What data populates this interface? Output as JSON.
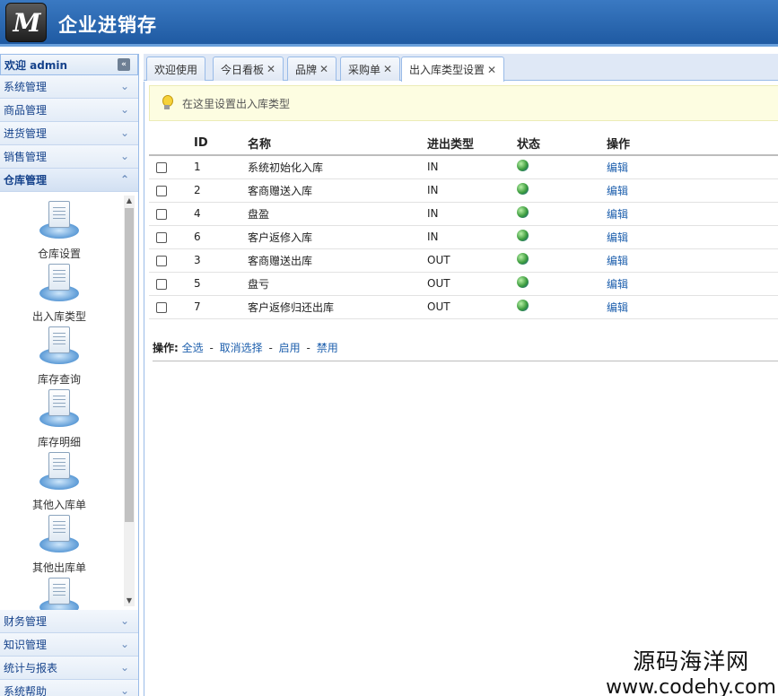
{
  "header": {
    "logo_letter": "M",
    "title": "企业进销存"
  },
  "sidebar": {
    "welcome": "欢迎 admin",
    "top_sections": [
      {
        "label": "系统管理"
      },
      {
        "label": "商品管理"
      },
      {
        "label": "进货管理"
      },
      {
        "label": "销售管理"
      },
      {
        "label": "仓库管理",
        "expanded": true
      }
    ],
    "warehouse_items": [
      {
        "label": "仓库设置"
      },
      {
        "label": "出入库类型"
      },
      {
        "label": "库存查询"
      },
      {
        "label": "库存明细"
      },
      {
        "label": "其他入库单"
      },
      {
        "label": "其他出库单"
      }
    ],
    "bottom_sections": [
      {
        "label": "财务管理"
      },
      {
        "label": "知识管理"
      },
      {
        "label": "统计与报表"
      },
      {
        "label": "系统帮助"
      }
    ]
  },
  "tabs": [
    {
      "label": "欢迎使用",
      "closable": false
    },
    {
      "label": "今日看板",
      "closable": true
    },
    {
      "label": "品牌",
      "closable": true
    },
    {
      "label": "采购单",
      "closable": true
    },
    {
      "label": "出入库类型设置",
      "closable": true,
      "active": true
    }
  ],
  "notice": "在这里设置出入库类型",
  "table": {
    "headers": {
      "id": "ID",
      "name": "名称",
      "type": "进出类型",
      "status": "状态",
      "action": "操作"
    },
    "rows": [
      {
        "id": "1",
        "name": "系统初始化入库",
        "type": "IN",
        "action": "编辑"
      },
      {
        "id": "2",
        "name": "客商赠送入库",
        "type": "IN",
        "action": "编辑"
      },
      {
        "id": "4",
        "name": "盘盈",
        "type": "IN",
        "action": "编辑"
      },
      {
        "id": "6",
        "name": "客户返修入库",
        "type": "IN",
        "action": "编辑"
      },
      {
        "id": "3",
        "name": "客商赠送出库",
        "type": "OUT",
        "action": "编辑"
      },
      {
        "id": "5",
        "name": "盘亏",
        "type": "OUT",
        "action": "编辑"
      },
      {
        "id": "7",
        "name": "客户返修归还出库",
        "type": "OUT",
        "action": "编辑"
      }
    ]
  },
  "actions": {
    "label": "操作:",
    "select_all": "全选",
    "deselect": "取消选择",
    "enable": "启用",
    "disable": "禁用",
    "separator": "-"
  },
  "watermark": {
    "line1": "源码海洋网",
    "line2": "www.codehy.com"
  },
  "colors": {
    "header": "#2a68b2",
    "accent_link": "#1d5fad",
    "notice_bg": "#fdfde1",
    "border": "#99bbe8"
  }
}
